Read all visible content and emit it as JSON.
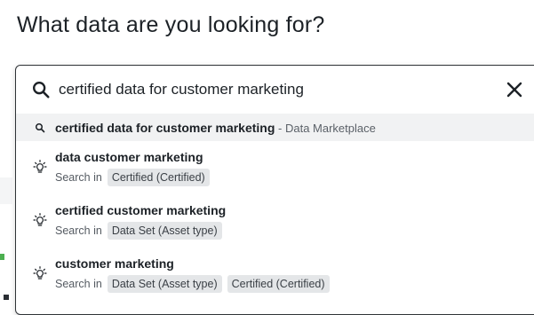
{
  "page": {
    "title": "What data are you looking for?"
  },
  "search": {
    "value": "certified data for customer marketing"
  },
  "suggestion": {
    "query": "certified data for customer marketing",
    "source": " - Data Marketplace"
  },
  "options": [
    {
      "title": "data customer marketing",
      "search_in": "Search in",
      "chips": [
        "Certified (Certified)"
      ]
    },
    {
      "title": "certified customer marketing",
      "search_in": "Search in",
      "chips": [
        "Data Set (Asset type)"
      ]
    },
    {
      "title": "customer marketing",
      "search_in": "Search in",
      "chips": [
        "Data Set (Asset type)",
        "Certified (Certified)"
      ]
    }
  ],
  "icons": {
    "search": "search-icon",
    "clear": "close-icon",
    "suggestion": "bulb-icon"
  },
  "colors": {
    "panel_border": "#2f3337",
    "chip_bg": "#e4e6e8",
    "highlight_row": "#f1f2f3"
  }
}
